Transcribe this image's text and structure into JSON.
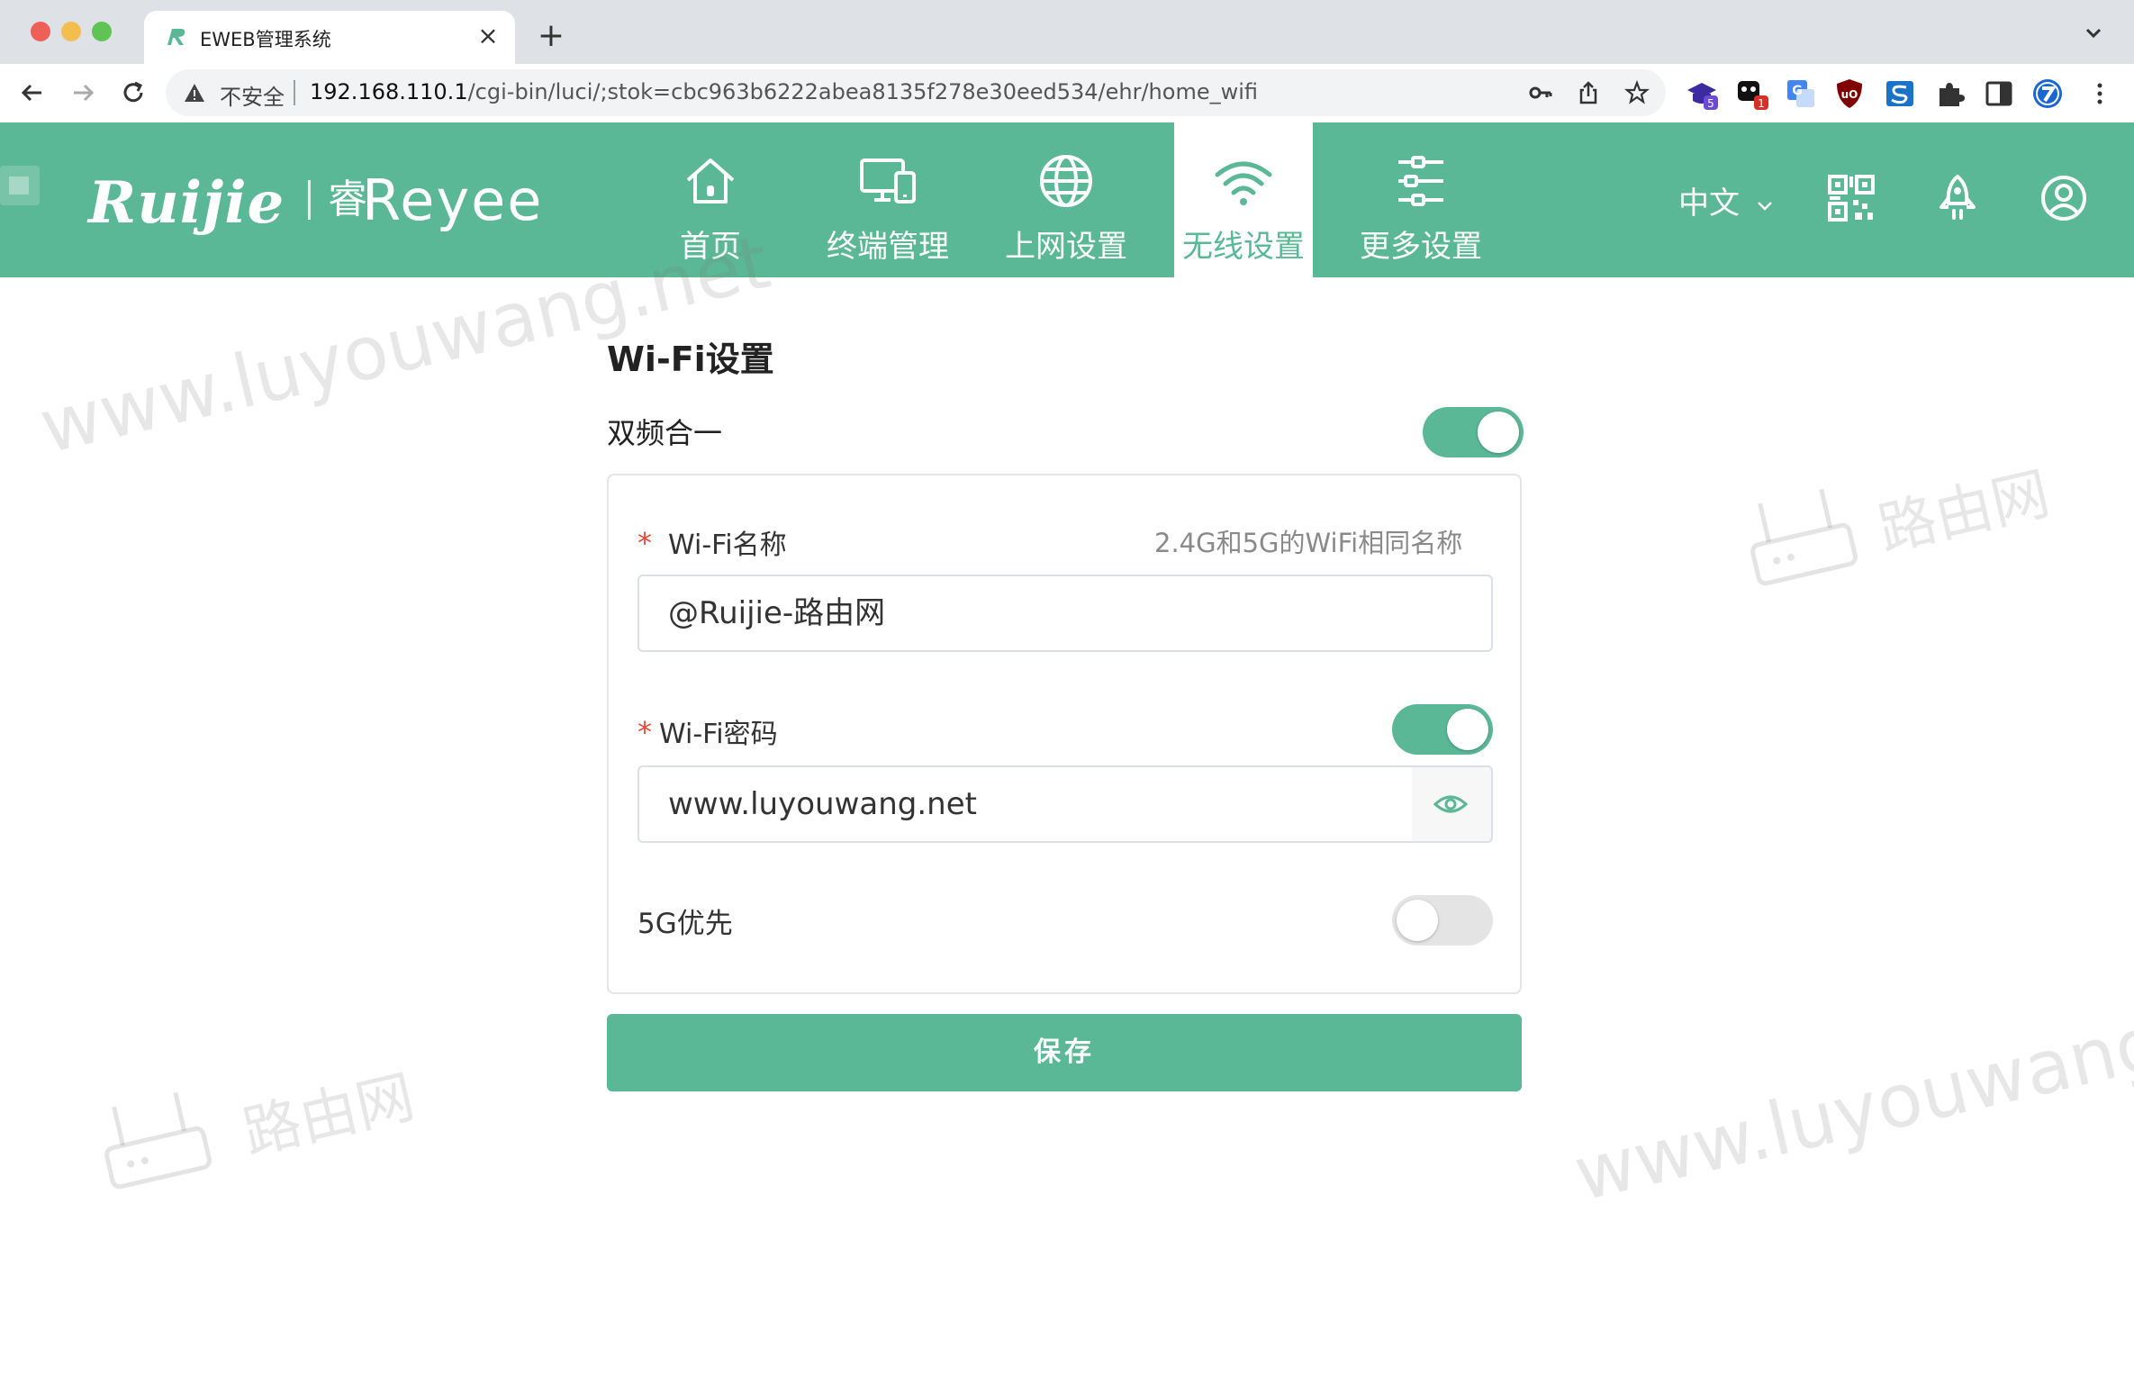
{
  "browser": {
    "tab_title": "EWEB管理系统",
    "tab_favicon": "ruijie-r-icon",
    "tab_close": "×",
    "new_tab": "+",
    "security_label": "不安全",
    "url_host": "192.168.110.1",
    "url_path": "/cgi-bin/luci/;stok=cbc963b6222abea8135f278e30eed534/ehr/home_wifi",
    "extension_badges": [
      "5",
      "1"
    ]
  },
  "header": {
    "brand": "Ruijie",
    "sub_brand_mark": "睿",
    "sub_brand": "Reyee",
    "nav": [
      {
        "label": "首页",
        "icon": "home-icon"
      },
      {
        "label": "终端管理",
        "icon": "devices-icon"
      },
      {
        "label": "上网设置",
        "icon": "globe-icon"
      },
      {
        "label": "无线设置",
        "icon": "wifi-icon",
        "active": true
      },
      {
        "label": "更多设置",
        "icon": "sliders-icon"
      }
    ],
    "language": "中文",
    "right_icons": [
      "qrcode-icon",
      "rocket-icon",
      "user-icon"
    ]
  },
  "page": {
    "title": "Wi-Fi设置",
    "dual_band": {
      "label": "双频合一",
      "enabled": true
    },
    "ssid": {
      "required_mark": "*",
      "label": "Wi-Fi名称",
      "hint": "2.4G和5G的WiFi相同名称",
      "value": "@Ruijie-路由网"
    },
    "password": {
      "required_mark": "*",
      "label": "Wi-Fi密码",
      "enabled": true,
      "value": "www.luyouwang.net"
    },
    "prefer_5g": {
      "label": "5G优先",
      "enabled": false
    },
    "save_label": "保存"
  },
  "watermark": {
    "url_text": "www.luyouwang.net",
    "cn_text": "路由网"
  },
  "colors": {
    "accent": "#5bb896",
    "required": "#e04b3a",
    "toggle_off": "#e4e4e4"
  }
}
